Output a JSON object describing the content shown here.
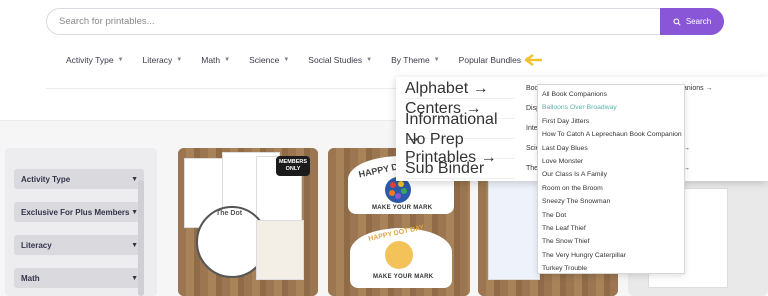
{
  "search": {
    "placeholder": "Search for printables...",
    "button_label": "Search"
  },
  "nav": {
    "items": [
      {
        "label": "Activity Type"
      },
      {
        "label": "Literacy"
      },
      {
        "label": "Math"
      },
      {
        "label": "Science"
      },
      {
        "label": "Social Studies"
      },
      {
        "label": "By Theme"
      },
      {
        "label": "Popular Bundles"
      }
    ],
    "caret": "▼"
  },
  "colors": {
    "accent": "#8a56d8",
    "indicator_arrow": "#f2c12e",
    "active_link": "#5bb3a8"
  },
  "sidebar": {
    "filters": [
      {
        "label": "Activity Type"
      },
      {
        "label": "Exclusive For Plus Members"
      },
      {
        "label": "Literacy"
      },
      {
        "label": "Math"
      }
    ]
  },
  "cards": [
    {
      "badge": "MEMBERS ONLY",
      "title": "The Dot"
    },
    {
      "crown_text": "HAPPY DOT DAY",
      "caption": "MAKE YOUR MARK"
    },
    {
      "crown_text": "HAPPY DOT DAY",
      "caption": "MAKE YOUR MARK"
    }
  ],
  "mega_menu": {
    "col1": [
      {
        "label": "Alphabet →"
      },
      {
        "label": "Centers →"
      },
      {
        "label": "Informational →"
      },
      {
        "label": "No Prep Printables →"
      },
      {
        "label": "Sub Binder"
      }
    ],
    "col2": [
      {
        "label": "Boo"
      },
      {
        "label": "Disp"
      },
      {
        "label": "Inte"
      },
      {
        "label": "Scie"
      },
      {
        "label": "The"
      }
    ],
    "col3": [
      {
        "label": "anions →"
      },
      {
        "label": "→"
      },
      {
        "label": "→"
      }
    ]
  },
  "submenu": {
    "items": [
      {
        "label": "All Book Companions"
      },
      {
        "label": "Balloons Over Broadway",
        "active": true
      },
      {
        "label": "First Day Jitters"
      },
      {
        "label": "How To Catch A Leprechaun Book Companion"
      },
      {
        "label": "Last Day Blues"
      },
      {
        "label": "Love Monster"
      },
      {
        "label": "Our Class Is A Family"
      },
      {
        "label": "Room on the Broom"
      },
      {
        "label": "Sneezy The Snowman"
      },
      {
        "label": "The Dot"
      },
      {
        "label": "The Leaf Thief"
      },
      {
        "label": "The Snow Thief"
      },
      {
        "label": "The Very Hungry Caterpillar"
      },
      {
        "label": "Turkey Trouble"
      }
    ]
  }
}
